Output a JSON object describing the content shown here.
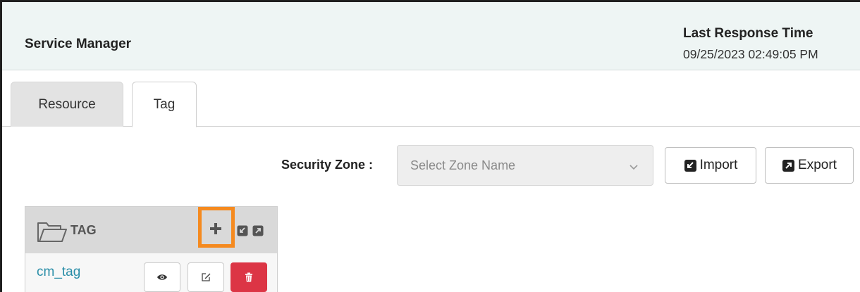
{
  "header": {
    "title": "Service Manager",
    "last_response_label": "Last Response Time",
    "last_response_value": "09/25/2023 02:49:05 PM"
  },
  "tabs": [
    {
      "label": "Resource",
      "active": false
    },
    {
      "label": "Tag",
      "active": true
    }
  ],
  "toolbar": {
    "security_zone_label": "Security Zone :",
    "zone_placeholder": "Select Zone Name",
    "import_label": "Import",
    "export_label": "Export"
  },
  "tag_panel": {
    "title": "TAG",
    "icons": [
      "folder-icon",
      "plus-icon",
      "import-icon",
      "export-icon"
    ],
    "highlight_color": "#f58a1f",
    "items": [
      {
        "name": "cm_tag"
      }
    ]
  },
  "colors": {
    "header_bg": "#eef5f4",
    "link": "#2a8ea8",
    "delete": "#dc3545"
  }
}
